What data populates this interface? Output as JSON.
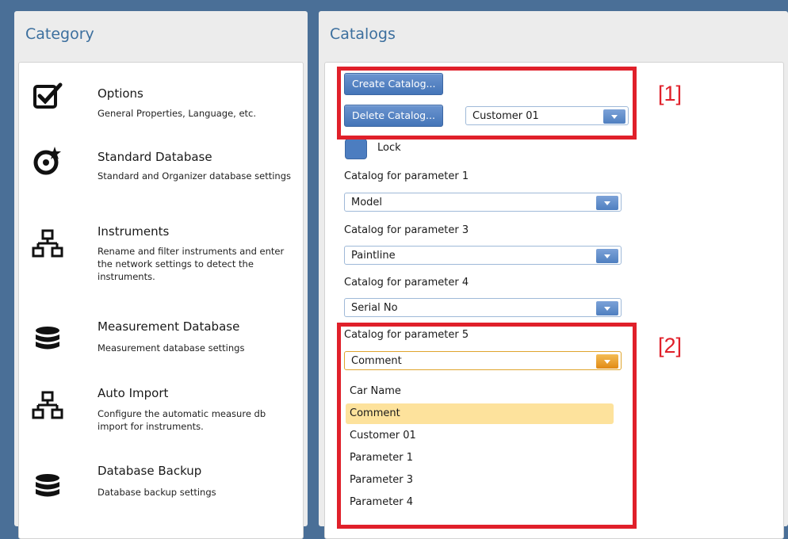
{
  "category": {
    "title": "Category",
    "items": [
      {
        "title": "Options",
        "desc": "General Properties, Language, etc.",
        "icon": "checkbox-check-icon"
      },
      {
        "title": "Standard Database",
        "desc": "Standard and Organizer database settings",
        "icon": "target-star-icon"
      },
      {
        "title": "Instruments",
        "desc": "Rename and filter instruments and enter the network settings to detect the instruments.",
        "icon": "network-icon"
      },
      {
        "title": "Measurement Database",
        "desc": "Measurement database settings",
        "icon": "database-icon"
      },
      {
        "title": "Auto Import",
        "desc": "Configure the automatic measure db import for instruments.",
        "icon": "network-icon"
      },
      {
        "title": "Database Backup",
        "desc": "Database backup settings",
        "icon": "database-icon"
      }
    ]
  },
  "catalogs": {
    "title": "Catalogs",
    "create_label": "Create Catalog...",
    "delete_label": "Delete Catalog...",
    "catalog_select": "Customer 01",
    "lock_label": "Lock",
    "params": [
      {
        "label": "Catalog for parameter 1",
        "value": "Model"
      },
      {
        "label": "Catalog for parameter 3",
        "value": "Paintline"
      },
      {
        "label": "Catalog for parameter 4",
        "value": "Serial No"
      },
      {
        "label": "Catalog for parameter 5",
        "value": "Comment"
      }
    ],
    "dropdown_options": [
      "Car Name",
      "Comment",
      "Customer 01",
      "Parameter 1",
      "Parameter 3",
      "Parameter 4"
    ]
  },
  "annotations": {
    "box1": "[1]",
    "box2": "[2]"
  },
  "colors": {
    "accent": "#4475b8",
    "annotation": "#e0202a",
    "selected": "#fde29c",
    "background": "#4a6f97"
  }
}
